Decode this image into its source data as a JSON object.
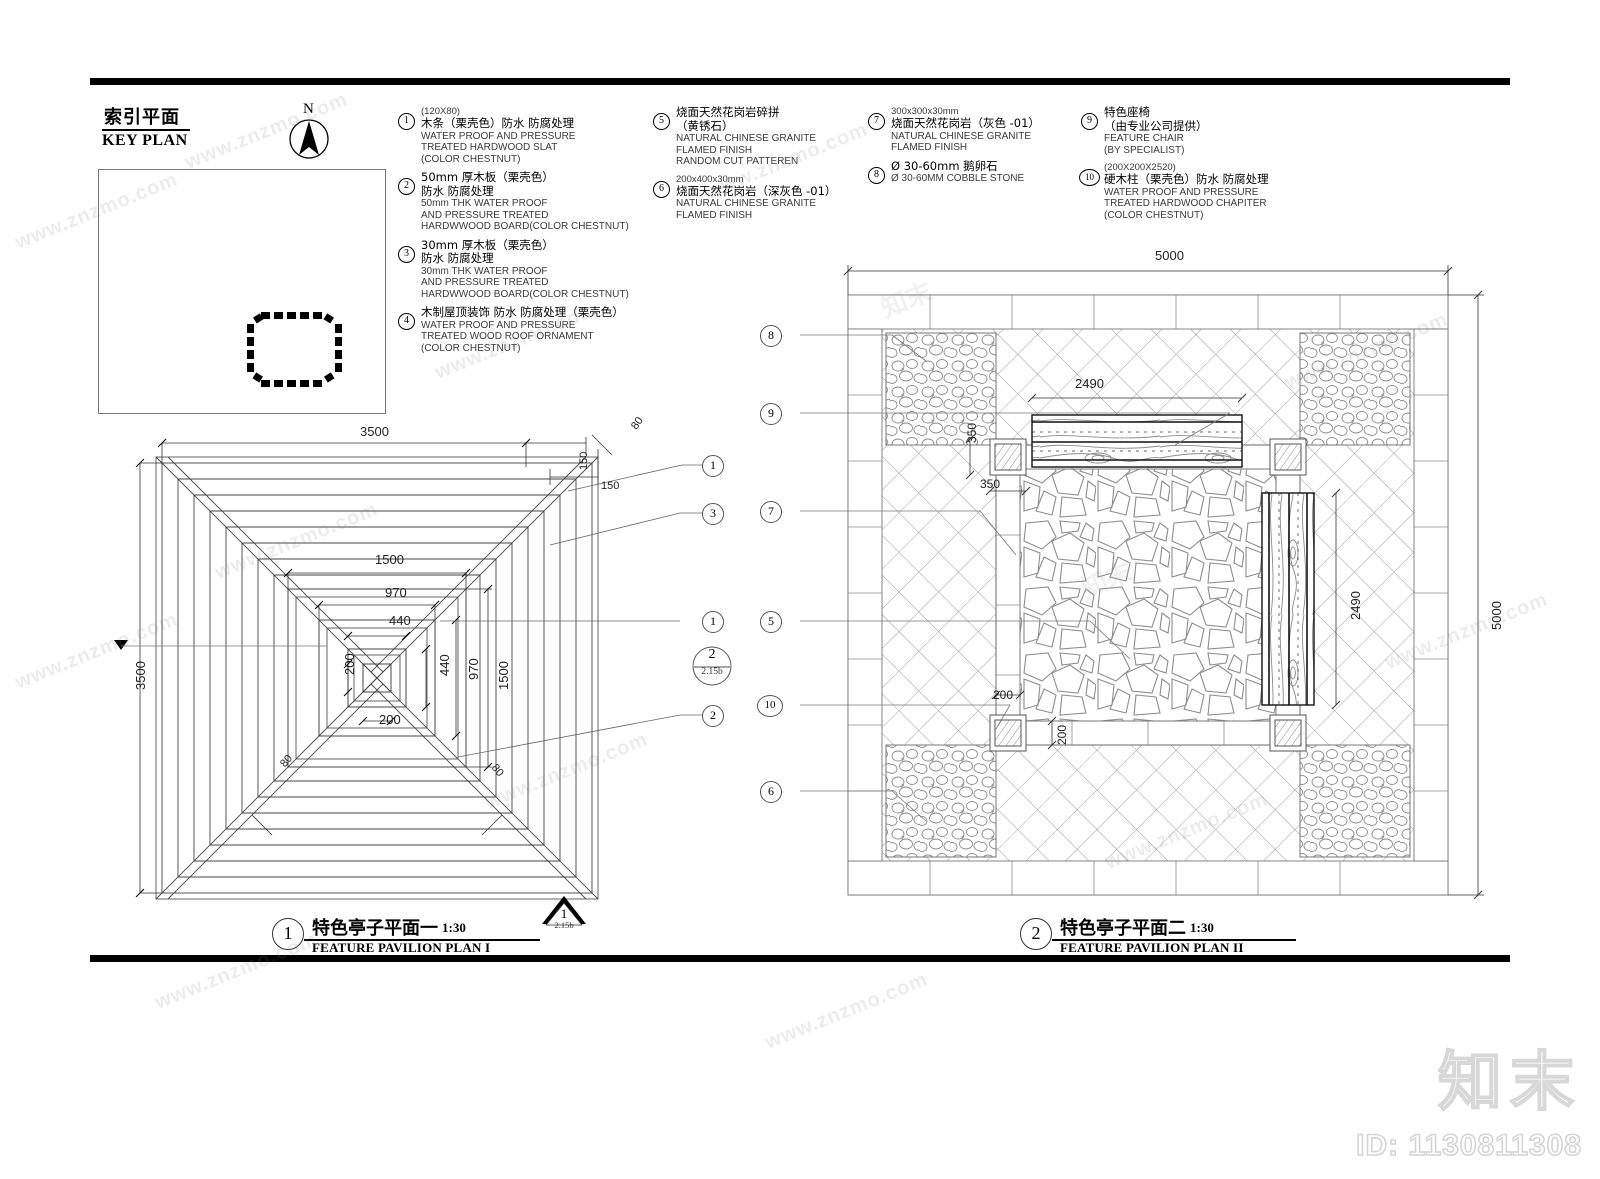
{
  "sheet": {
    "key_plan": {
      "title_cn": "索引平面",
      "title_en": "KEY PLAN",
      "north_label": "N"
    },
    "legend": {
      "columns": [
        {
          "items": [
            {
              "num": "1",
              "size": "(120X80)",
              "cn": [
                "木条（栗壳色）防水 防腐处理"
              ],
              "en": [
                "WATER PROOF AND PRESSURE",
                "TREATED HARDWOOD SLAT",
                "(COLOR CHESTNUT)"
              ]
            },
            {
              "num": "2",
              "size": "",
              "cn": [
                "50mm 厚木板（栗壳色）",
                "防水 防腐处理"
              ],
              "en": [
                "50mm THK WATER PROOF",
                "AND PRESSURE TREATED",
                "HARDWWOOD BOARD(COLOR CHESTNUT)"
              ]
            },
            {
              "num": "3",
              "size": "",
              "cn": [
                "30mm 厚木板（栗壳色）",
                "防水 防腐处理"
              ],
              "en": [
                "30mm THK WATER PROOF",
                "AND PRESSURE TREATED",
                "HARDWWOOD BOARD(COLOR CHESTNUT)"
              ]
            },
            {
              "num": "4",
              "size": "",
              "cn": [
                "木制屋顶装饰 防水 防腐处理（栗壳色）"
              ],
              "en": [
                "WATER PROOF AND PRESSURE",
                "TREATED WOOD ROOF ORNAMENT",
                "(COLOR CHESTNUT)"
              ]
            }
          ]
        },
        {
          "items": [
            {
              "num": "5",
              "size": "",
              "cn": [
                "烧面天然花岗岩碎拼",
                "（黄锈石）"
              ],
              "en": [
                "NATURAL CHINESE GRANITE",
                "FLAMED FINISH",
                "RANDOM CUT PATTEREN"
              ]
            },
            {
              "num": "6",
              "size": "200x400x30mm",
              "cn": [
                "烧面天然花岗岩（深灰色 -01）"
              ],
              "en": [
                "NATURAL CHINESE GRANITE",
                "FLAMED FINISH"
              ]
            }
          ]
        },
        {
          "items": [
            {
              "num": "7",
              "size": "300x300x30mm",
              "cn": [
                "烧面天然花岗岩（灰色 -01）"
              ],
              "en": [
                "NATURAL CHINESE GRANITE",
                "FLAMED FINISH"
              ]
            },
            {
              "num": "8",
              "size": "",
              "cn": [
                "Ø 30-60mm 鹅卵石"
              ],
              "en": [
                "Ø 30-60MM COBBLE STONE"
              ]
            }
          ]
        },
        {
          "items": [
            {
              "num": "9",
              "size": "",
              "cn": [
                "特色座椅",
                "（由专业公司提供）"
              ],
              "en": [
                "FEATURE CHAIR",
                "(BY SPECIALIST)"
              ]
            },
            {
              "num": "10",
              "size": "(200X200X2520)",
              "cn": [
                "硬木柱（栗壳色）防水 防腐处理"
              ],
              "en": [
                "WATER PROOF AND PRESSURE",
                "TREATED HARDWOOD CHAPITER",
                "(COLOR CHESTNUT)"
              ]
            }
          ]
        }
      ]
    },
    "plan1": {
      "title_cn": "特色亭子平面一",
      "title_en": "FEATURE PAVILION PLAN I",
      "scale": "1:30",
      "number": "1",
      "dimensions": {
        "overall_w": "3500",
        "overall_h": "3500",
        "ring2_w": "1500",
        "ring2_h": "1500",
        "ring3_w": "970",
        "ring3_h": "970",
        "ring4_w": "440",
        "ring4_h": "440",
        "core_w": "200",
        "core_h": "200",
        "eave_a": "150",
        "eave_b": "150",
        "slat_t": "80",
        "hip_a": "80",
        "hip_b": "80"
      },
      "callouts": [
        "1",
        "3",
        "1",
        "2"
      ],
      "section_flag": {
        "num": "2",
        "sub": "2.15b"
      },
      "section_flag_bottom": {
        "num": "1",
        "sub": "2.15b"
      }
    },
    "plan2": {
      "title_cn": "特色亭子平面二",
      "title_en": "FEATURE PAVILION PLAN II",
      "scale": "1:30",
      "number": "2",
      "dimensions": {
        "overall_w": "5000",
        "overall_h": "5000",
        "bench_len": "2490",
        "bench_len2": "2490",
        "col_w": "350",
        "col_h": "350",
        "kerb_w": "200",
        "kerb_h": "200"
      },
      "callouts": [
        "8",
        "9",
        "7",
        "5",
        "10",
        "6"
      ]
    },
    "watermarks": {
      "tile_text": "www.znzmo.com",
      "brand_cn": "知末",
      "brand_id": "ID: 1130811308"
    }
  }
}
